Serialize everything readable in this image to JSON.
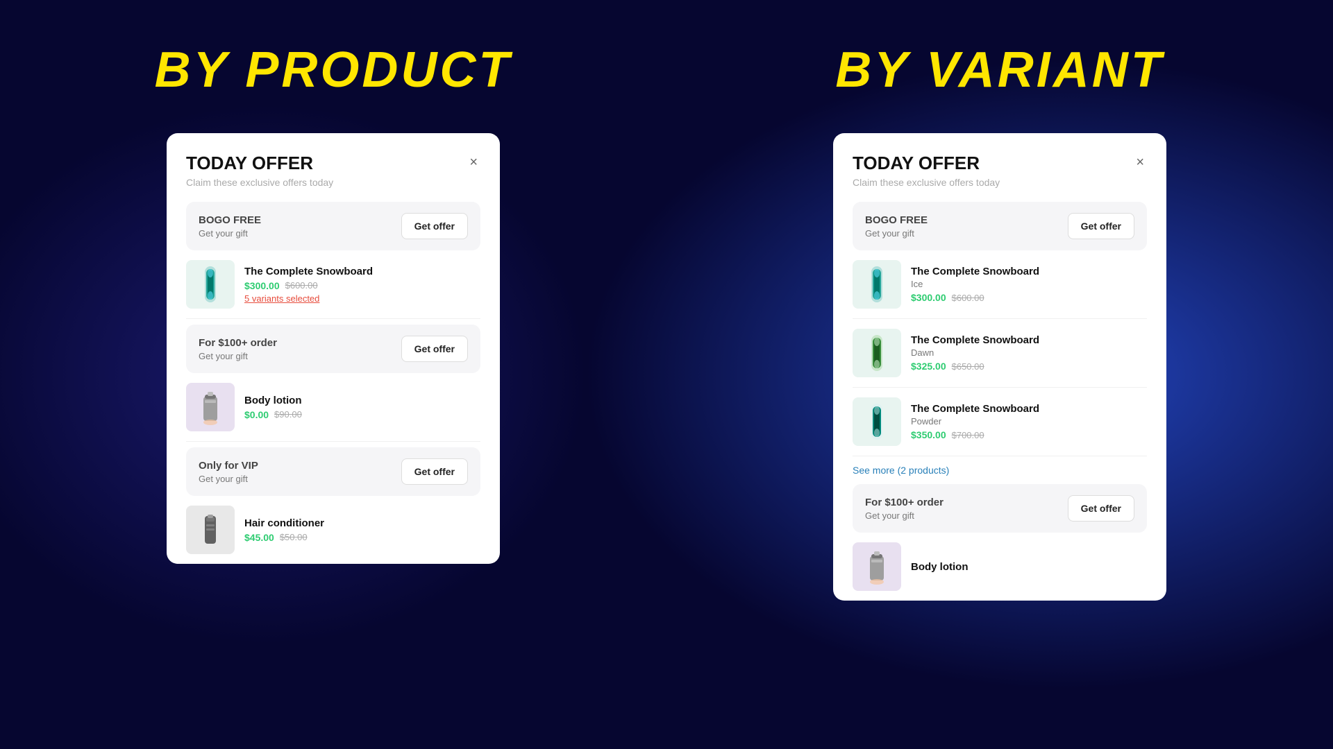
{
  "columns": [
    {
      "title": "BY PRODUCT",
      "card": {
        "title": "TODAY OFFER",
        "subtitle": "Claim these exclusive offers today",
        "close_label": "×",
        "sections": [
          {
            "offer_label": "BOGO FREE",
            "offer_sublabel": "Get your gift",
            "btn_label": "Get offer",
            "products": [
              {
                "name": "The Complete Snowboard",
                "variant": null,
                "price_current": "$300.00",
                "price_original": "$600.00",
                "variants_selected": "5 variants selected",
                "type": "snowboard"
              }
            ]
          },
          {
            "offer_label": "For $100+ order",
            "offer_sublabel": "Get your gift",
            "btn_label": "Get offer",
            "products": [
              {
                "name": "Body lotion",
                "variant": null,
                "price_current": "$0.00",
                "price_original": "$90.00",
                "variants_selected": null,
                "type": "lotion"
              }
            ]
          },
          {
            "offer_label": "Only for VIP",
            "offer_sublabel": "Get your gift",
            "btn_label": "Get offer",
            "products": [
              {
                "name": "Hair conditioner",
                "variant": null,
                "price_current": "$45.00",
                "price_original": "$50.00",
                "variants_selected": null,
                "type": "conditioner"
              }
            ]
          }
        ]
      }
    },
    {
      "title": "BY VARIANT",
      "card": {
        "title": "TODAY OFFER",
        "subtitle": "Claim these exclusive offers today",
        "close_label": "×",
        "sections": [
          {
            "offer_label": "BOGO FREE",
            "offer_sublabel": "Get your gift",
            "btn_label": "Get offer",
            "products": [
              {
                "name": "The Complete Snowboard",
                "variant": "Ice",
                "price_current": "$300.00",
                "price_original": "$600.00",
                "variants_selected": null,
                "type": "snowboard"
              },
              {
                "name": "The Complete Snowboard",
                "variant": "Dawn",
                "price_current": "$325.00",
                "price_original": "$650.00",
                "variants_selected": null,
                "type": "snowboard"
              },
              {
                "name": "The Complete Snowboard",
                "variant": "Powder",
                "price_current": "$350.00",
                "price_original": "$700.00",
                "variants_selected": null,
                "type": "snowboard"
              }
            ],
            "see_more": "See more (2 products)"
          },
          {
            "offer_label": "For $100+ order",
            "offer_sublabel": "Get your gift",
            "btn_label": "Get offer",
            "products": [
              {
                "name": "Body lotion",
                "variant": null,
                "price_current": null,
                "price_original": null,
                "variants_selected": null,
                "type": "lotion"
              }
            ]
          }
        ]
      }
    }
  ],
  "icons": {
    "close": "×"
  }
}
